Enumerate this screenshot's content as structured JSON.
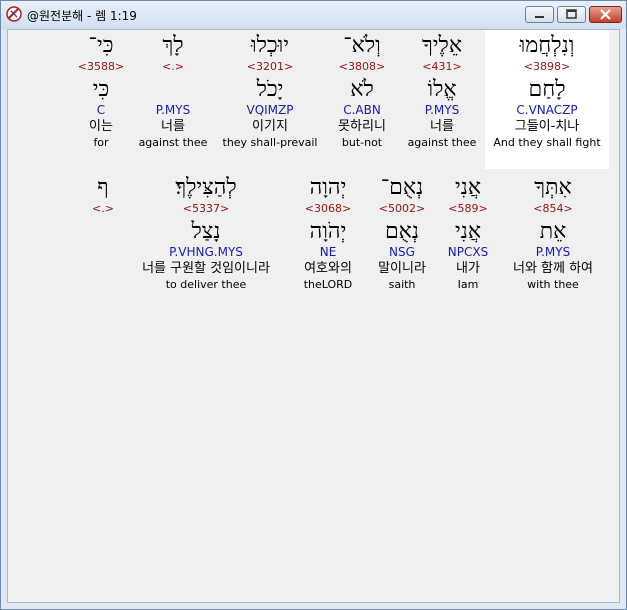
{
  "window": {
    "title": "@원전분해 - 렘 1:19",
    "colors": {
      "strong": "#9a1111",
      "morph": "#1a1aaa",
      "selected_bg": "#ffffff"
    }
  },
  "line1": [
    {
      "heb": "וְנִלְחֲמוּ",
      "strong": "<3898>",
      "lemma": "לָחַם",
      "morph": "C.VNACZP",
      "kor": "그들이-치나",
      "eng": "And they shall fight",
      "selected": true
    },
    {
      "heb": "אֵלֶיךָ",
      "strong": "<431>",
      "lemma": "אֱלוֹ",
      "morph": "P.MYS",
      "kor": "너를",
      "eng": "against thee"
    },
    {
      "heb": "וְלֹא־",
      "strong": "<3808>",
      "lemma": "לֹא",
      "morph": "C.ABN",
      "kor": "못하리니",
      "eng": "but-not"
    },
    {
      "heb": "יוּכְלוּ",
      "strong": "<3201>",
      "lemma": "יָכֹל",
      "morph": "VQIMZP",
      "kor": "이기지",
      "eng": "they shall-prevail"
    },
    {
      "heb": "לָךְ",
      "strong": "<.>",
      "lemma": "",
      "morph": "P.MYS",
      "kor": "너를",
      "eng": "against thee"
    },
    {
      "heb": "כִּי־",
      "strong": "<3588>",
      "lemma": "כִּי",
      "morph": "C",
      "kor": "이는",
      "eng": "for"
    }
  ],
  "line2": [
    {
      "heb": "אִתְּךָ",
      "strong": "<854>",
      "lemma": "אֵת",
      "morph": "P.MYS",
      "kor": "너와 함께 하여",
      "eng": "with thee"
    },
    {
      "heb": "אֲנִי",
      "strong": "<589>",
      "lemma": "אֲנִי",
      "morph": "NPCXS",
      "kor": "내가",
      "eng": "Iam"
    },
    {
      "heb": "נְאֻם־",
      "strong": "<5002>",
      "lemma": "נְאֻם",
      "morph": "NSG",
      "kor": "말이니라",
      "eng": "saith"
    },
    {
      "heb": "יְהוָה",
      "strong": "<3068>",
      "lemma": "יְהֹוָה",
      "morph": "NE",
      "kor": "여호와의",
      "eng": "theLORD"
    },
    {
      "heb": "לְהַצִּילֶךָ׃",
      "strong": "<5337>",
      "lemma": "נָצַל",
      "morph": "P.VHNG.MYS",
      "kor": "너를 구원할 것임이니라",
      "eng": "to deliver thee"
    },
    {
      "heb": "ף",
      "strong": "<.>",
      "lemma": "",
      "morph": "",
      "kor": "",
      "eng": ""
    }
  ]
}
